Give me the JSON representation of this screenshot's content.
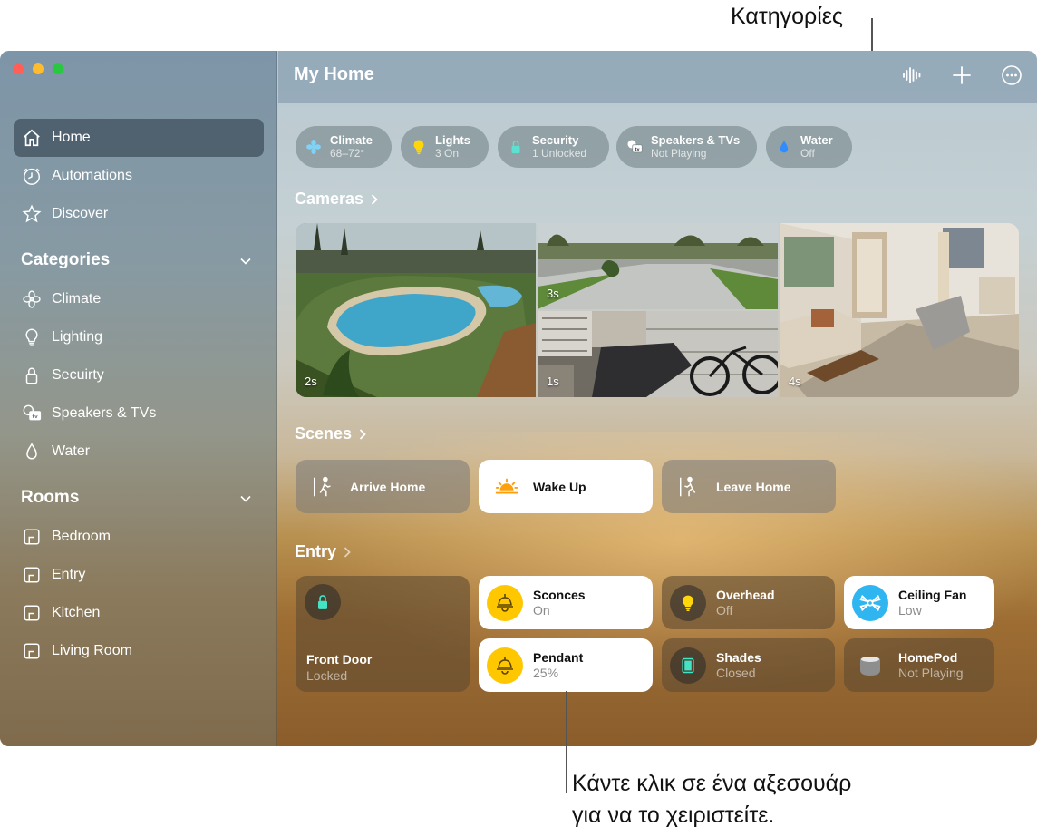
{
  "callouts": {
    "categories": "Κατηγορίες",
    "accessory_line1": "Κάντε κλικ σε ένα αξεσουάρ",
    "accessory_line2": "για να το χειριστείτε."
  },
  "window": {
    "title": "My Home"
  },
  "sidebar": {
    "nav": [
      {
        "label": "Home",
        "icon": "house-icon",
        "selected": true
      },
      {
        "label": "Automations",
        "icon": "clock-icon"
      },
      {
        "label": "Discover",
        "icon": "star-icon"
      }
    ],
    "categories_heading": "Categories",
    "categories": [
      {
        "label": "Climate",
        "icon": "fan-icon"
      },
      {
        "label": "Lighting",
        "icon": "lightbulb-icon"
      },
      {
        "label": "Secuirty",
        "icon": "lock-icon"
      },
      {
        "label": "Speakers & TVs",
        "icon": "tv-icon"
      },
      {
        "label": "Water",
        "icon": "drop-icon"
      }
    ],
    "rooms_heading": "Rooms",
    "rooms": [
      {
        "label": "Bedroom",
        "icon": "room-icon"
      },
      {
        "label": "Entry",
        "icon": "room-icon"
      },
      {
        "label": "Kitchen",
        "icon": "room-icon"
      },
      {
        "label": "Living Room",
        "icon": "room-icon"
      }
    ]
  },
  "toolbar": {
    "icons": [
      "intercom-waveform-icon",
      "plus-icon",
      "more-ellipsis-icon"
    ]
  },
  "status_pills": [
    {
      "title": "Climate",
      "sub": "68–72°",
      "icon": "fan-icon",
      "color": "#7fd3f7"
    },
    {
      "title": "Lights",
      "sub": "3 On",
      "icon": "lightbulb-icon",
      "color": "#ffd60a"
    },
    {
      "title": "Security",
      "sub": "1 Unlocked",
      "icon": "lock-icon",
      "color": "#5ee0d0"
    },
    {
      "title": "Speakers & TVs",
      "sub": "Not Playing",
      "icon": "tv-icon",
      "color": "#ffffff"
    },
    {
      "title": "Water",
      "sub": "Off",
      "icon": "drop-icon",
      "color": "#2f8cff"
    }
  ],
  "cameras": {
    "heading": "Cameras",
    "feeds": [
      {
        "label": "2s",
        "scene": "backyard-pool"
      },
      {
        "label": "3s",
        "scene": "driveway"
      },
      {
        "label": "1s",
        "scene": "garage"
      },
      {
        "label": "4s",
        "scene": "living-room"
      }
    ]
  },
  "scenes": {
    "heading": "Scenes",
    "items": [
      {
        "label": "Arrive Home",
        "icon": "arrive-home-icon",
        "active": false
      },
      {
        "label": "Wake Up",
        "icon": "sunrise-icon",
        "active": true
      },
      {
        "label": "Leave Home",
        "icon": "leave-home-icon",
        "active": false
      }
    ]
  },
  "entry": {
    "heading": "Entry",
    "front_door": {
      "name": "Front Door",
      "state": "Locked",
      "icon": "lock-icon"
    },
    "accessories": [
      {
        "name": "Sconces",
        "state": "On",
        "icon": "light-fixture-icon",
        "active": true
      },
      {
        "name": "Overhead",
        "state": "Off",
        "icon": "lightbulb-icon",
        "active": false
      },
      {
        "name": "Ceiling Fan",
        "state": "Low",
        "icon": "ceiling-fan-icon",
        "active": true
      },
      {
        "name": "Pendant",
        "state": "25%",
        "icon": "light-fixture-icon",
        "active": true
      },
      {
        "name": "Shades",
        "state": "Closed",
        "icon": "shades-icon",
        "active": false
      },
      {
        "name": "HomePod",
        "state": "Not Playing",
        "icon": "homepod-icon",
        "active": false
      }
    ]
  },
  "colors": {
    "accent_yellow": "#ffc700",
    "fan_blue": "#2fb5f0",
    "lock_teal": "#43e3c6"
  }
}
